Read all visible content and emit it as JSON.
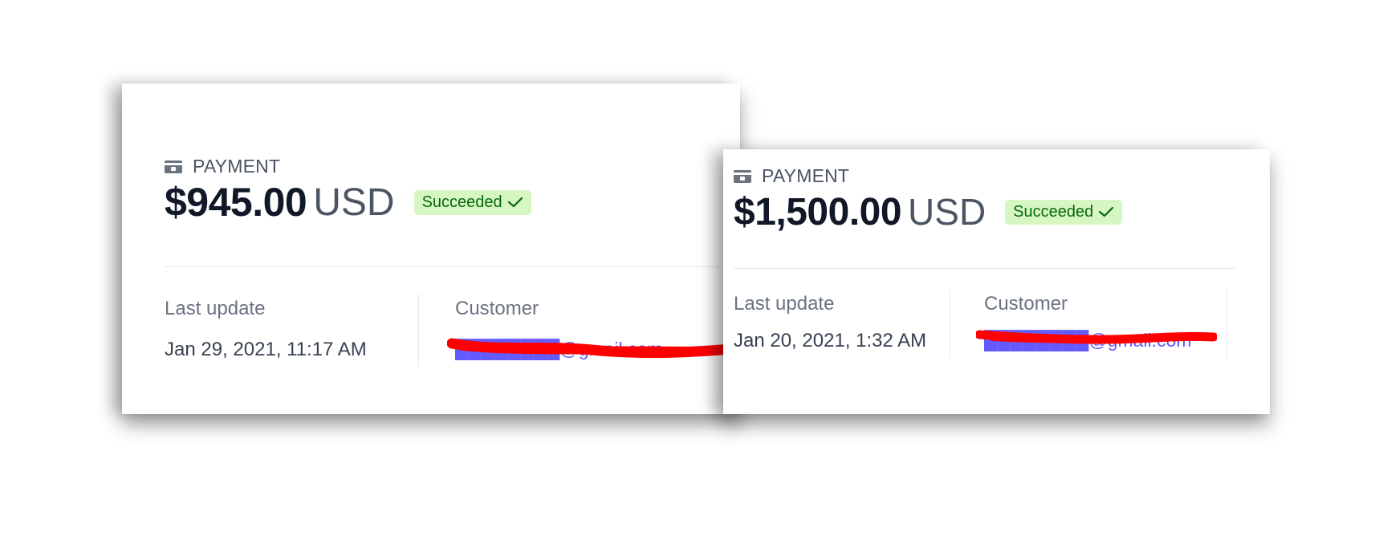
{
  "payments": [
    {
      "type_label": "PAYMENT",
      "amount": "$945.00",
      "currency": "USD",
      "status": "Succeeded",
      "last_update_label": "Last update",
      "last_update_value": "Jan 29, 2021, 11:17 AM",
      "customer_label": "Customer",
      "customer_email": "████████@gmail.com"
    },
    {
      "type_label": "PAYMENT",
      "amount": "$1,500.00",
      "currency": "USD",
      "status": "Succeeded",
      "last_update_label": "Last update",
      "last_update_value": "Jan 20, 2021, 1:32 AM",
      "customer_label": "Customer",
      "customer_email": "████████@gmail.com"
    }
  ],
  "colors": {
    "status_bg": "#d7f7c2",
    "status_text": "#05690d",
    "link": "#635bff",
    "redaction": "#ff0000"
  },
  "icons": {
    "payment": "credit-card-icon",
    "status": "check-icon"
  }
}
